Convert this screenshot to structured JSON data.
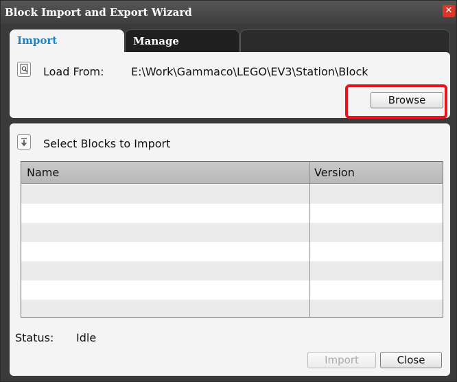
{
  "window": {
    "title": "Block Import and Export Wizard",
    "close_glyph": "✕"
  },
  "tabs": [
    {
      "label": "Import",
      "active": true
    },
    {
      "label": "Manage",
      "active": false
    }
  ],
  "load_from": {
    "label": "Load From:",
    "path": "E:\\Work\\Gammaco\\LEGO\\EV3\\Station\\Block",
    "icon": "document-search-icon",
    "browse_label": "Browse"
  },
  "select_blocks": {
    "label": "Select Blocks to Import",
    "icon": "download-arrow-icon"
  },
  "table": {
    "columns": [
      "Name",
      "Version"
    ],
    "rows": []
  },
  "status": {
    "label": "Status:",
    "value": "Idle"
  },
  "footer": {
    "import_label": "Import",
    "close_label": "Close"
  },
  "colors": {
    "active_tab_text": "#1a84c9",
    "highlight": "#e8131b",
    "title_bar": "#3e3e3e"
  }
}
